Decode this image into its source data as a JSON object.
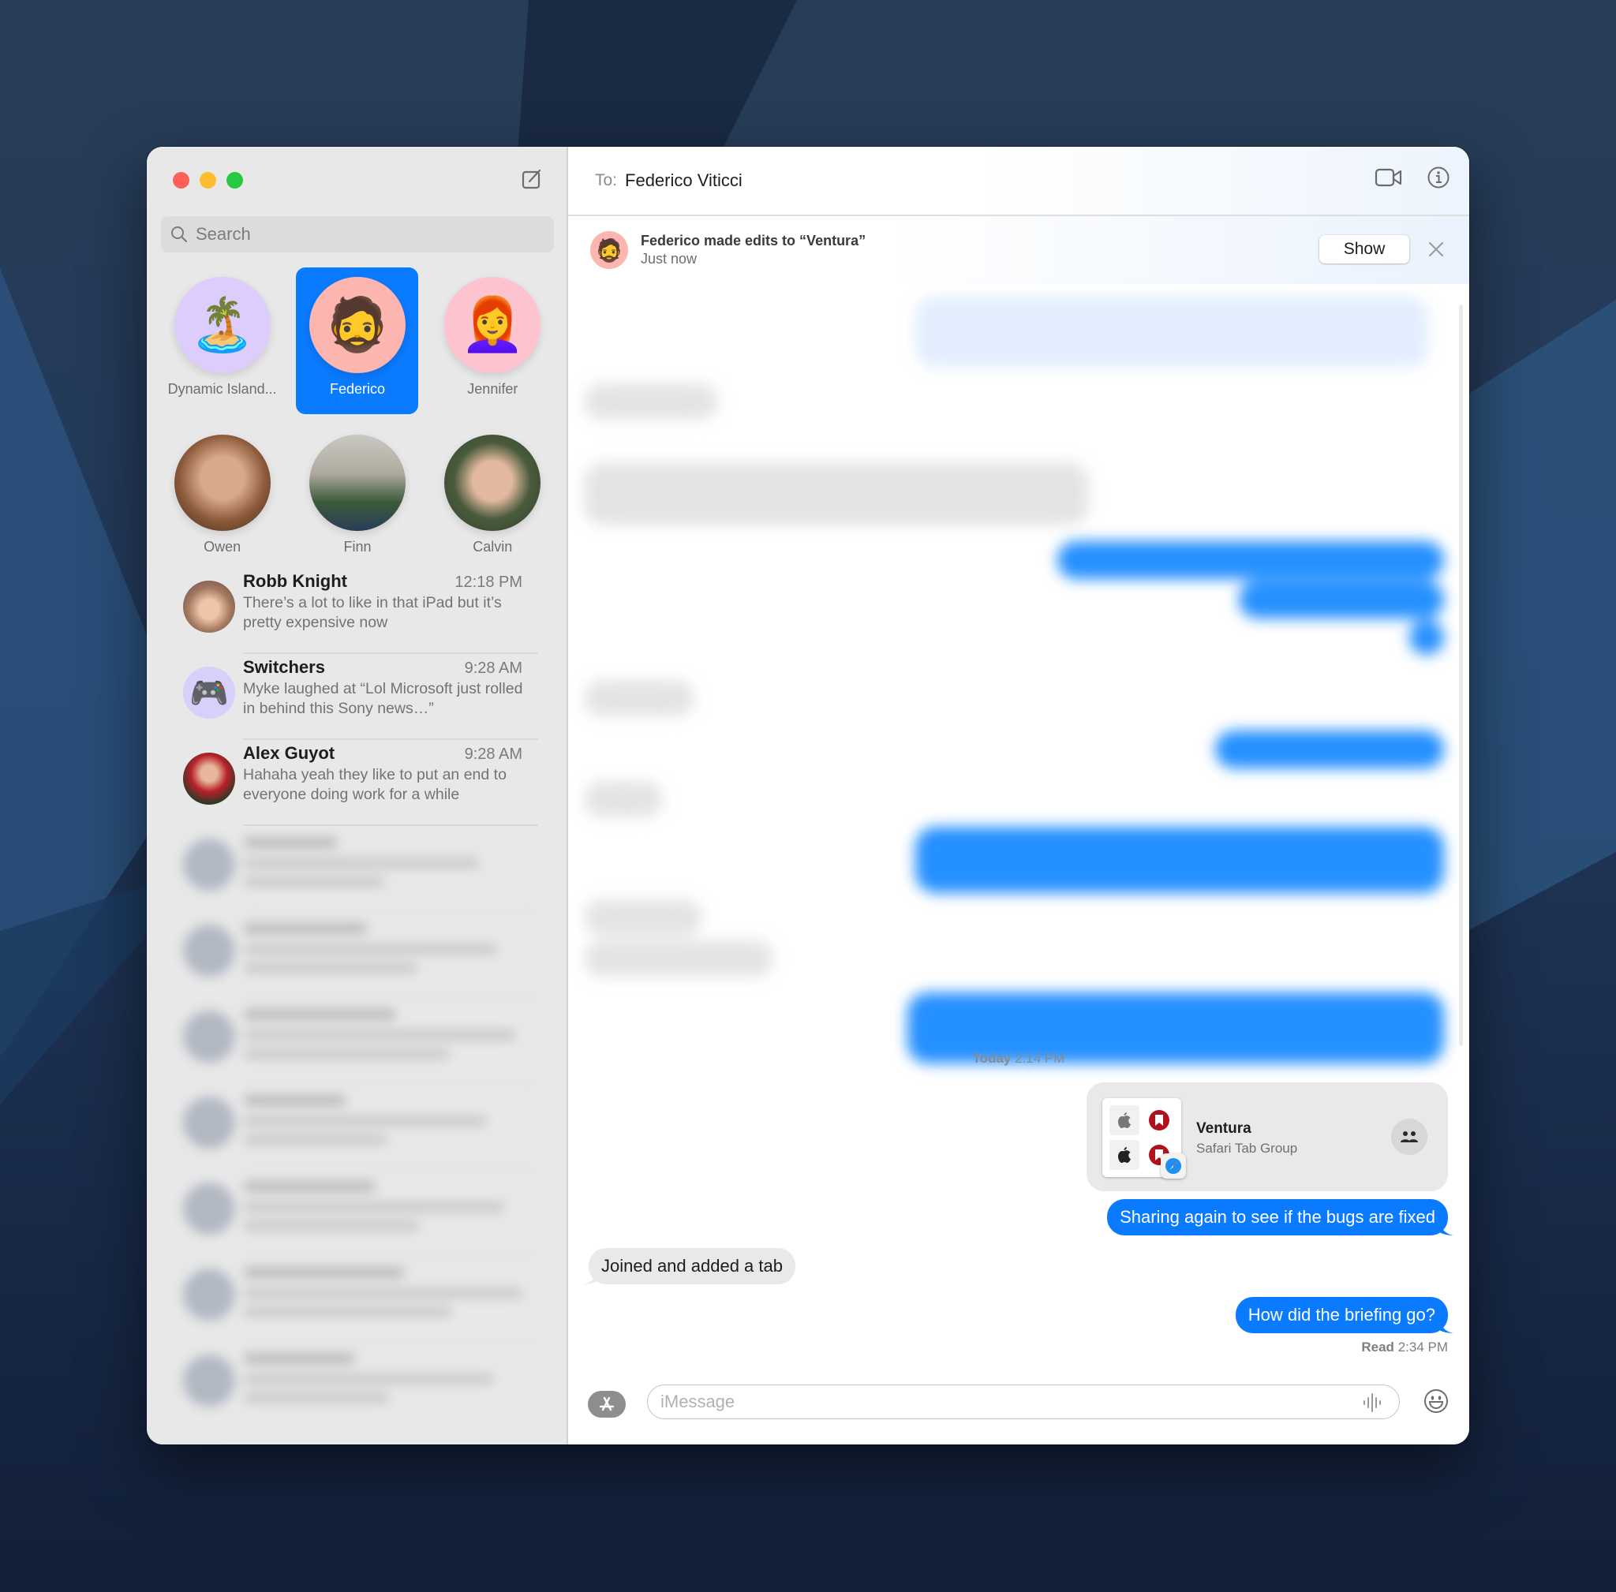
{
  "window": {
    "to_label": "To:",
    "recipient": "Federico Viticci"
  },
  "sidebar": {
    "search_placeholder": "Search",
    "pinned": [
      {
        "name": "Dynamic Island...",
        "avatar": "palm-tree-island-emoji",
        "glyph": "🏝️",
        "selected": false
      },
      {
        "name": "Federico",
        "avatar": "memoji-bearded-glasses",
        "glyph": "🧔",
        "selected": true
      },
      {
        "name": "Jennifer",
        "avatar": "memoji-redhead",
        "glyph": "👩‍🦰",
        "selected": false
      },
      {
        "name": "Owen",
        "avatar": "photo",
        "glyph": "",
        "selected": false
      },
      {
        "name": "Finn",
        "avatar": "photo",
        "glyph": "",
        "selected": false
      },
      {
        "name": "Calvin",
        "avatar": "photo",
        "glyph": "",
        "selected": false
      }
    ],
    "conversations": [
      {
        "name": "Robb Knight",
        "time": "12:18 PM",
        "preview": "There’s a lot to like in that iPad but it’s pretty expensive now",
        "avatar": "photo"
      },
      {
        "name": "Switchers",
        "time": "9:28 AM",
        "preview": "Myke laughed at “Lol Microsoft just rolled in behind this Sony news…”",
        "avatar": "game-controller-emoji",
        "glyph": "🎮"
      },
      {
        "name": "Alex Guyot",
        "time": "9:28 AM",
        "preview": "Hahaha yeah they like to put an end to everyone doing work for a while",
        "avatar": "photo"
      }
    ],
    "blurred_conversation_count": 7
  },
  "banner": {
    "title": "Federico made edits to “Ventura”",
    "subtitle": "Just now",
    "show_label": "Show"
  },
  "thread": {
    "timestamp_day": "Today",
    "timestamp_time": "2:14 PM",
    "shared_card": {
      "title": "Ventura",
      "subtitle": "Safari Tab Group"
    },
    "messages": [
      {
        "direction": "out",
        "text": "Sharing again to see if the bugs are fixed"
      },
      {
        "direction": "in",
        "text": "Joined and added a tab"
      },
      {
        "direction": "out",
        "text": "How did the briefing go?"
      }
    ],
    "read_label": "Read",
    "read_time": "2:34 PM"
  },
  "composer": {
    "placeholder": "iMessage"
  },
  "colors": {
    "accent": "#0a7aff",
    "incoming_bubble": "#e9e9eb",
    "sidebar_bg": "#e8e8e8"
  }
}
